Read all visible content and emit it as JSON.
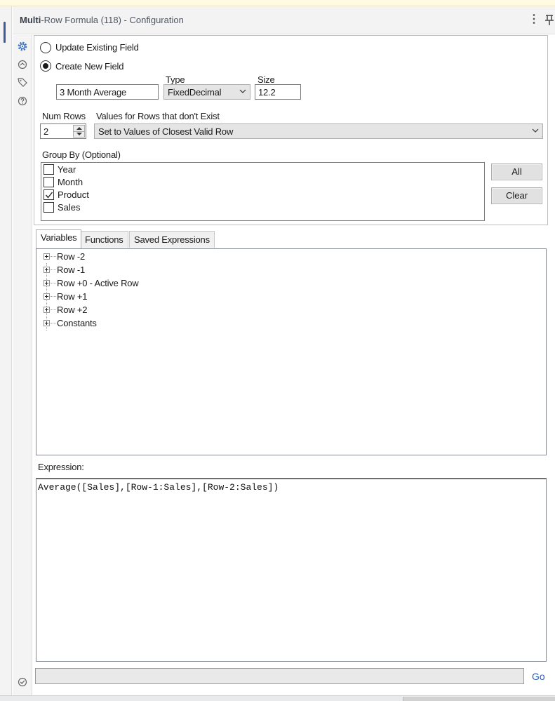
{
  "window": {
    "title_bold": "Multi",
    "title_rest": "-Row Formula (118) - Configuration"
  },
  "options": {
    "update_existing_label": "Update Existing Field",
    "create_new_label": "Create New  Field",
    "selected": "create_new"
  },
  "new_field": {
    "name": "3 Month Average",
    "type_label": "Type",
    "type_value": "FixedDecimal",
    "size_label": "Size",
    "size_value": "12.2"
  },
  "num_rows": {
    "label": "Num Rows",
    "value": "2"
  },
  "missing_rows": {
    "label": "Values for Rows that don't Exist",
    "value": "Set to Values of Closest Valid Row"
  },
  "group_by": {
    "label": "Group By (Optional)",
    "fields": [
      {
        "name": "Year",
        "checked": false
      },
      {
        "name": "Month",
        "checked": false
      },
      {
        "name": "Product",
        "checked": true
      },
      {
        "name": "Sales",
        "checked": false
      }
    ],
    "all_button": "All",
    "clear_button": "Clear"
  },
  "tabs": [
    {
      "label": "Variables",
      "active": true
    },
    {
      "label": "Functions",
      "active": false
    },
    {
      "label": "Saved Expressions",
      "active": false
    }
  ],
  "variables": [
    "Row -2",
    "Row -1",
    "Row +0 - Active Row",
    "Row +1",
    "Row +2",
    "Constants"
  ],
  "expression": {
    "label": "Expression:",
    "text": "Average([Sales],[Row-1:Sales],[Row-2:Sales])"
  },
  "go_label": "Go",
  "colors": {
    "accent": "#2a5db0",
    "sidebar_active": "#3e73c4"
  }
}
